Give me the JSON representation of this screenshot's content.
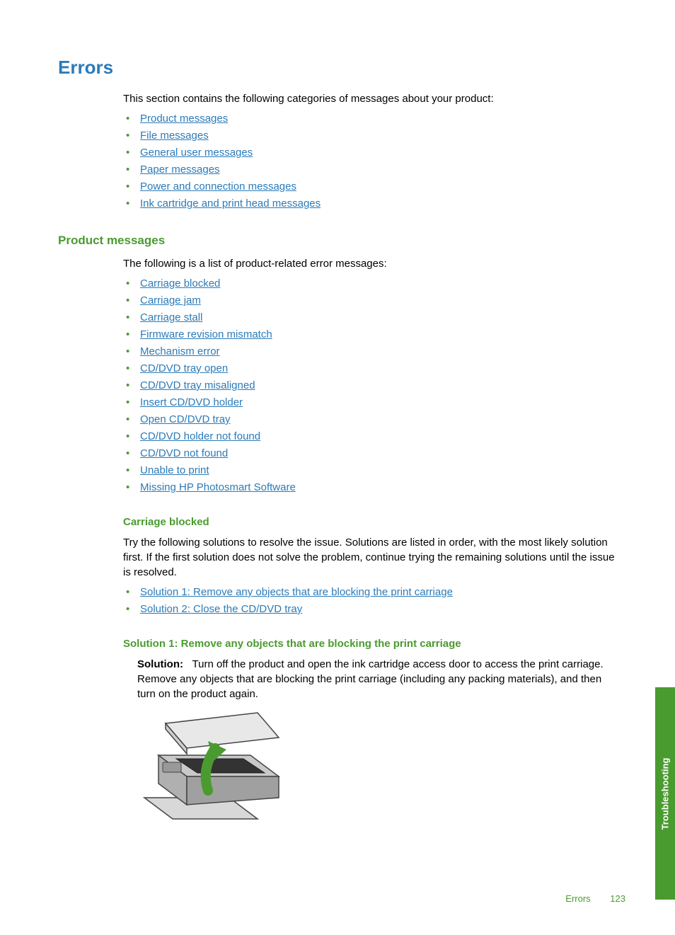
{
  "h1": "Errors",
  "intro1": "This section contains the following categories of messages about your product:",
  "categories": [
    "Product messages",
    "File messages",
    "General user messages",
    "Paper messages",
    "Power and connection messages",
    "Ink cartridge and print head messages"
  ],
  "h2": "Product messages",
  "intro2": "The following is a list of product-related error messages:",
  "product_msgs": [
    "Carriage blocked",
    "Carriage jam",
    "Carriage stall",
    "Firmware revision mismatch",
    "Mechanism error",
    "CD/DVD tray open",
    "CD/DVD tray misaligned",
    "Insert CD/DVD holder",
    "Open CD/DVD tray",
    "CD/DVD holder not found",
    "CD/DVD not found",
    "Unable to print",
    "Missing HP Photosmart Software"
  ],
  "h3": "Carriage blocked",
  "cb_text": "Try the following solutions to resolve the issue. Solutions are listed in order, with the most likely solution first. If the first solution does not solve the problem, continue trying the remaining solutions until the issue is resolved.",
  "cb_sols": [
    "Solution 1: Remove any objects that are blocking the print carriage",
    "Solution 2: Close the CD/DVD tray"
  ],
  "h4": "Solution 1: Remove any objects that are blocking the print carriage",
  "sol_label": "Solution:",
  "sol_text": "Turn off the product and open the ink cartridge access door to access the print carriage. Remove any objects that are blocking the print carriage (including any packing materials), and then turn on the product again.",
  "side_tab": "Troubleshooting",
  "footer_label": "Errors",
  "page_num": "123"
}
